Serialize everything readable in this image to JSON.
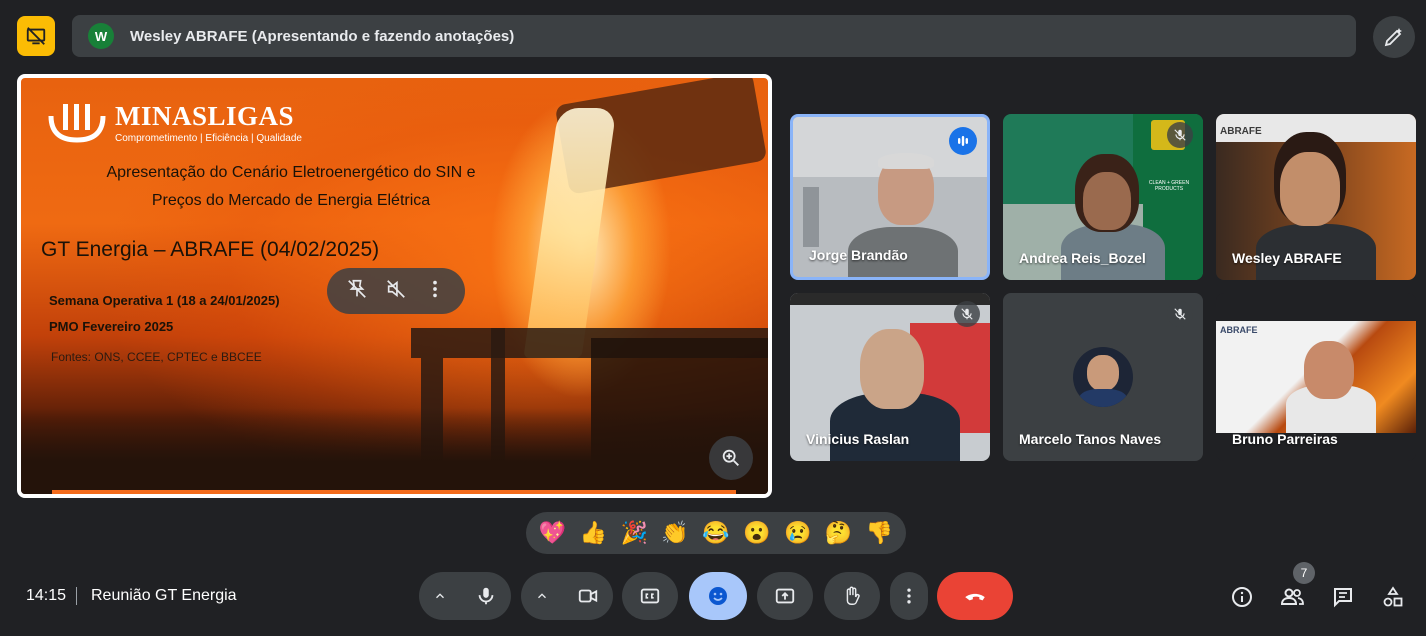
{
  "presenter": {
    "initial": "W",
    "text": "Wesley ABRAFE (Apresentando e fazendo anotações)"
  },
  "slide": {
    "brand": "MINASLIGAS",
    "tagline": "Comprometimento | Eficiência | Qualidade",
    "title_line1": "Apresentação do Cenário Eletroenergético do SIN e",
    "title_line2": "Preços do Mercado de Energia Elétrica",
    "subtitle": "GT Energia – ABRAFE (04/02/2025)",
    "line_week": "Semana Operativa 1  (18 a 24/01/2025)",
    "line_pmo": "PMO Fevereiro 2025",
    "line_sources": "Fontes: ONS, CCEE, CPTEC e BBCEE"
  },
  "participants": [
    {
      "name": "Jorge Brandão",
      "speaking": true
    },
    {
      "name": "Andrea Reis_Bozel",
      "muted": true
    },
    {
      "name": "Wesley ABRAFE"
    },
    {
      "name": "Vinicius Raslan",
      "muted": true
    },
    {
      "name": "Marcelo Tanos Naves",
      "muted": true
    },
    {
      "name": "Bruno Parreiras"
    }
  ],
  "tile_labels": {
    "tile3_logo": "ABRAFE",
    "tile6_logo": "ABRAFE",
    "tile2_logo": "CLEAN + GREEN PRODUCTS"
  },
  "reactions": [
    "💖",
    "👍",
    "🎉",
    "👏",
    "😂",
    "😮",
    "😢",
    "🤔",
    "👎"
  ],
  "footer": {
    "time": "14:15",
    "meeting": "Reunião GT Energia",
    "people_count": "7"
  },
  "colors": {
    "background": "#202124",
    "control": "#3c4043",
    "active": "#a8c7fa",
    "leave": "#ea4335",
    "speaking_border": "#8ab4f8"
  },
  "icons": [
    "presentation-off-icon",
    "annotate-icon",
    "pin-off-icon",
    "volume-off-icon",
    "more-vert-icon",
    "zoom-in-icon",
    "mic-icon",
    "camera-icon",
    "captions-icon",
    "emoji-icon",
    "present-icon",
    "raise-hand-icon",
    "call-end-icon",
    "info-icon",
    "people-icon",
    "chat-icon",
    "activities-icon"
  ]
}
